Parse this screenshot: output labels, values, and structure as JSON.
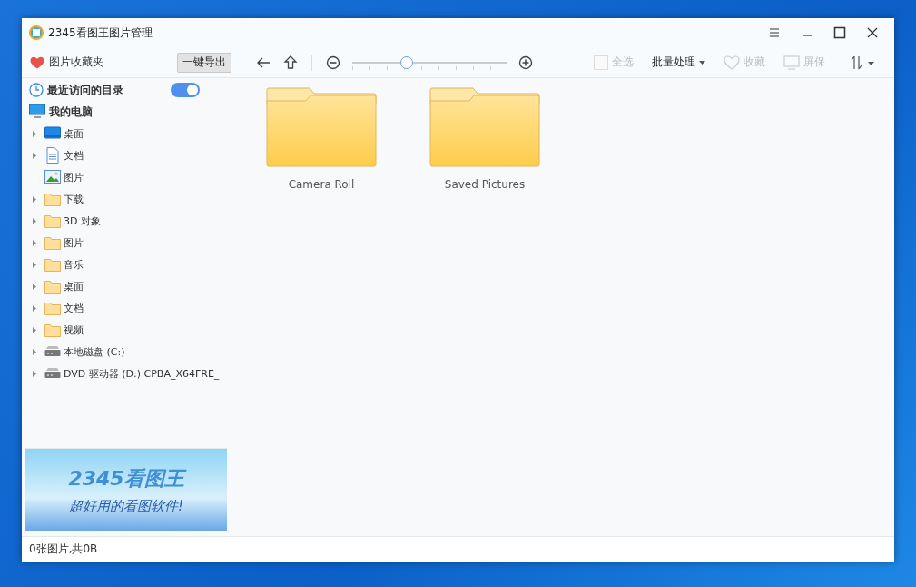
{
  "window": {
    "title": "2345看图王图片管理"
  },
  "toolbar": {
    "favorites": "图片收藏夹",
    "export_button": "一键导出",
    "zoom_slider": {
      "level": 0.35
    },
    "actions": [
      {
        "kind": "checkbox",
        "label": "全选",
        "disabled": true,
        "checked": false
      },
      {
        "kind": "menu",
        "label": "批量处理",
        "disabled": false
      },
      {
        "kind": "heart",
        "label": "收藏",
        "disabled": true
      },
      {
        "kind": "screen",
        "label": "屏保",
        "disabled": true
      }
    ]
  },
  "sidebar": {
    "recent": {
      "label": "最近访问的目录",
      "on": true
    },
    "tree": [
      {
        "label": "我的电脑",
        "kind": "computer",
        "children": [
          {
            "label": "桌面",
            "kind": "desktop",
            "expandable": true
          },
          {
            "label": "文档",
            "kind": "document",
            "expandable": true
          },
          {
            "label": "图片",
            "kind": "picture",
            "expandable": false
          },
          {
            "label": "下载",
            "kind": "folder",
            "expandable": true
          },
          {
            "label": "3D 对象",
            "kind": "folder",
            "expandable": true
          },
          {
            "label": "图片",
            "kind": "folder",
            "expandable": true
          },
          {
            "label": "音乐",
            "kind": "folder",
            "expandable": true
          },
          {
            "label": "桌面",
            "kind": "folder",
            "expandable": true
          },
          {
            "label": "文档",
            "kind": "folder",
            "expandable": true
          },
          {
            "label": "视频",
            "kind": "folder",
            "expandable": true
          },
          {
            "label": "本地磁盘 (C:)",
            "kind": "drive",
            "expandable": true
          },
          {
            "label": "DVD 驱动器 (D:) CPBA_X64FRE_",
            "kind": "drive",
            "expandable": true
          }
        ]
      }
    ],
    "banner": {
      "brand": "2345看图王",
      "slogan": "超好用的看图软件!"
    }
  },
  "folders": [
    {
      "name": "Camera Roll"
    },
    {
      "name": "Saved Pictures"
    }
  ],
  "status_bar": "0张图片,共0B"
}
